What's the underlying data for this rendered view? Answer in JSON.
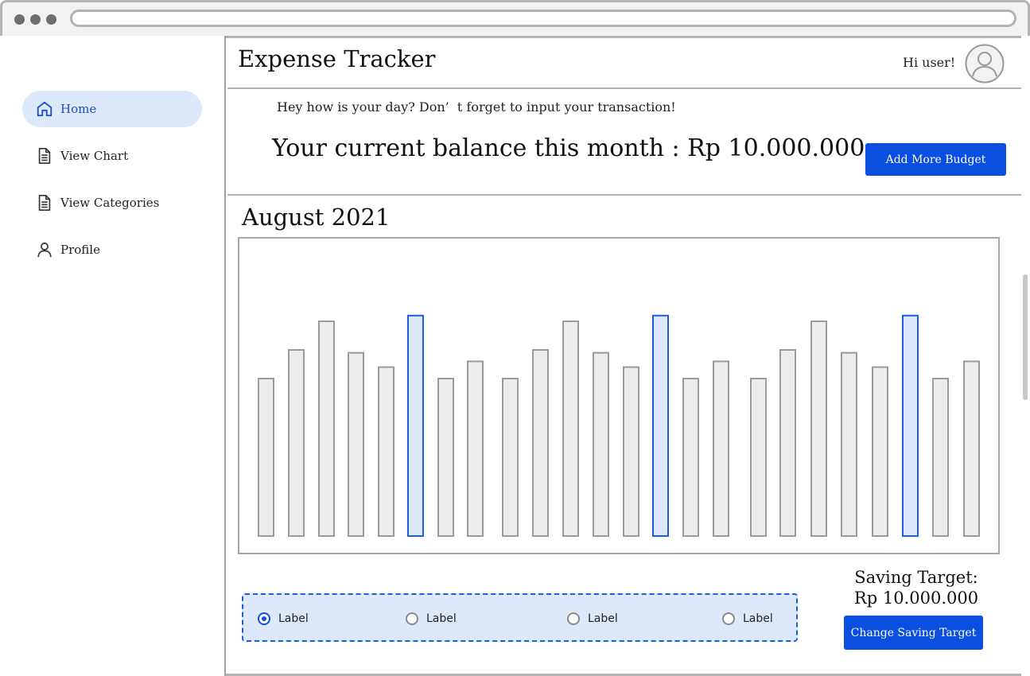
{
  "app": {
    "title": "Expense Tracker",
    "greeting": "Hi user!"
  },
  "sidebar": {
    "items": [
      {
        "label": "Home",
        "icon": "home-icon",
        "active": true
      },
      {
        "label": "View Chart",
        "icon": "document-icon",
        "active": false
      },
      {
        "label": "View Categories",
        "icon": "document-icon",
        "active": false
      },
      {
        "label": "Profile",
        "icon": "user-icon",
        "active": false
      }
    ]
  },
  "banner": {
    "message": "Hey how is your day? Don’  t forget to input your transaction!",
    "balance_text": "Your current balance this month : Rp 10.000.000",
    "add_budget_label": "Add More Budget"
  },
  "chart_section": {
    "month": "August 2021"
  },
  "chart_data": {
    "type": "bar",
    "values": [
      55,
      65,
      75,
      64,
      59,
      77,
      55,
      61,
      55,
      65,
      75,
      64,
      59,
      77,
      55,
      61,
      55,
      65,
      75,
      64,
      59,
      77,
      55,
      61
    ],
    "highlighted_indices": [
      5,
      13,
      21
    ],
    "ylim": [
      0,
      100
    ],
    "grid": false,
    "colors": {
      "normal_fill": "#ececec",
      "normal_stroke": "#9a9a9a",
      "highlight_fill": "#dde8fb",
      "highlight_stroke": "#1b5fe0"
    }
  },
  "saving": {
    "label_line1": "Saving Target:",
    "label_line2": "Rp 10.000.000",
    "change_label": "Change Saving Target"
  },
  "radio_options": [
    {
      "label": "Label",
      "checked": true
    },
    {
      "label": "Label",
      "checked": false
    },
    {
      "label": "Label",
      "checked": false
    },
    {
      "label": "Label",
      "checked": false
    }
  ],
  "colors": {
    "accent": "#0b4fe0",
    "active_bg": "#dde8fb",
    "border": "#b3b3b3"
  }
}
